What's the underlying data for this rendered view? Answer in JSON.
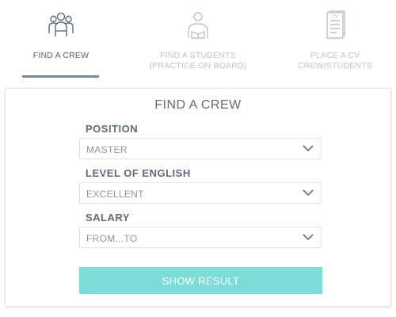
{
  "tabs": [
    {
      "label_line1": "FIND A CREW",
      "label_line2": "",
      "icon": "crew-group-icon",
      "active": true
    },
    {
      "label_line1": "FIND A STUDENTS",
      "label_line2": "(PRACTICE ON BOARD)",
      "icon": "student-icon",
      "active": false
    },
    {
      "label_line1": "PLACE A CV",
      "label_line2": "CREW/STUDENTS",
      "icon": "cv-document-icon",
      "active": false
    }
  ],
  "form": {
    "title": "FIND A CREW",
    "position": {
      "label": "POSITION",
      "value": "MASTER"
    },
    "english": {
      "label": "LEVEL OF ENGLISH",
      "value": "EXCELLENT"
    },
    "salary": {
      "label": "SALARY",
      "value": "FROM...TO"
    },
    "submit_label": "SHOW RESULT"
  },
  "colors": {
    "accent_button": "#7edcd8",
    "active_tab_underline": "#7d8a97",
    "inactive_tab_text": "#bcc4cc"
  }
}
